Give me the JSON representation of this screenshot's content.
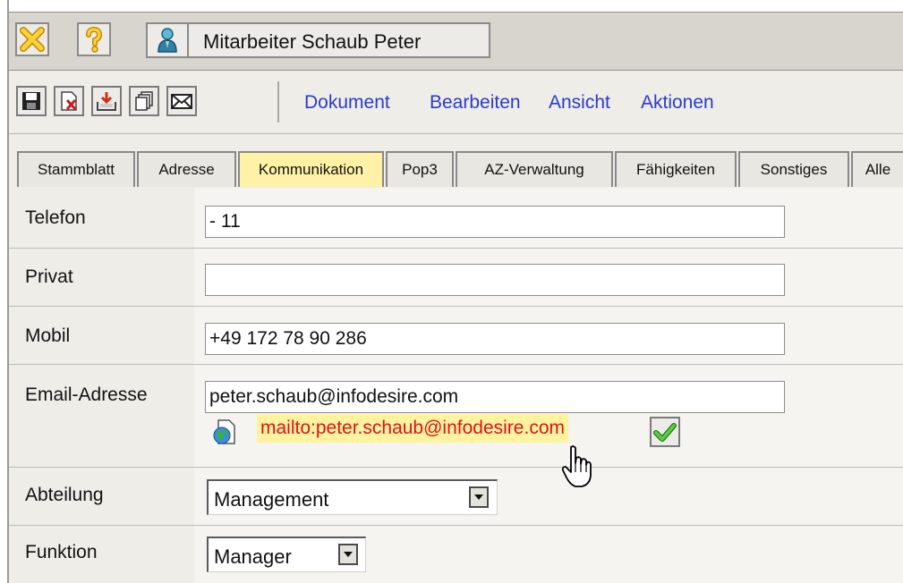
{
  "window": {
    "title": "Mitarbeiter Schaub Peter",
    "icons": [
      "close-icon",
      "help-icon",
      "user-icon"
    ]
  },
  "toolbar": {
    "icons": [
      "save-icon",
      "delete-icon",
      "import-icon",
      "copy-icon",
      "email-icon"
    ],
    "menu": [
      "Dokument",
      "Bearbeiten",
      "Ansicht",
      "Aktionen"
    ]
  },
  "tabs": [
    {
      "label": "Stammblatt",
      "active": false
    },
    {
      "label": "Adresse",
      "active": false
    },
    {
      "label": "Kommunikation",
      "active": true
    },
    {
      "label": "Pop3",
      "active": false
    },
    {
      "label": "AZ-Verwaltung",
      "active": false
    },
    {
      "label": "Fähigkeiten",
      "active": false
    },
    {
      "label": "Sonstiges",
      "active": false
    },
    {
      "label": "Alle",
      "active": false
    }
  ],
  "form": {
    "telefon": {
      "label": "Telefon",
      "value": "- 11"
    },
    "privat": {
      "label": "Privat",
      "value": ""
    },
    "mobil": {
      "label": "Mobil",
      "value": "+49 172 78 90 286"
    },
    "email": {
      "label": "Email-Adresse",
      "value": "peter.schaub@infodesire.com",
      "mailto": "mailto:peter.schaub@infodesire.com"
    },
    "abteilung": {
      "label": "Abteilung",
      "value": "Management"
    },
    "funktion": {
      "label": "Funktion",
      "value": "Manager"
    }
  },
  "colors": {
    "active_tab": "#fff1a6",
    "menu_link": "#2a3bd0",
    "mailto_text": "#e0111a",
    "mailto_highlight": "#fff3a0"
  }
}
